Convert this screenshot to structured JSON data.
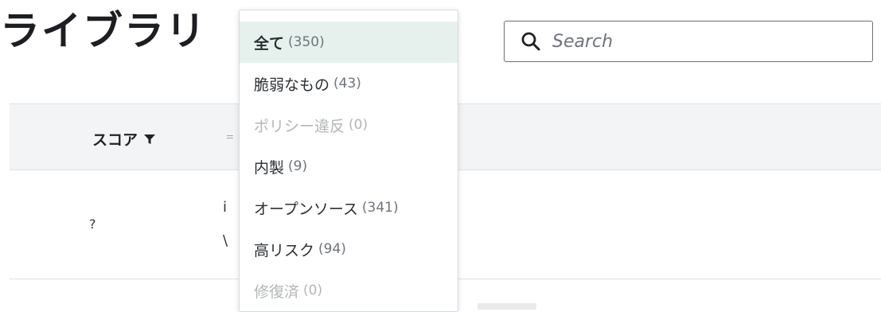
{
  "page": {
    "title": "ライブラリ"
  },
  "search": {
    "placeholder": "Search",
    "icon": "search-icon"
  },
  "table": {
    "header": {
      "score_label": "スコア",
      "score_filter_icon": "filter-icon",
      "second_column_fragment": "゠"
    },
    "rows": [
      {
        "score": "?",
        "fragment_line1": "i",
        "fragment_line2": "\\"
      }
    ]
  },
  "filter_dropdown": {
    "items": [
      {
        "label": "全て",
        "count": "(350)",
        "state": "selected"
      },
      {
        "label": "脆弱なもの",
        "count": "(43)",
        "state": "normal"
      },
      {
        "label": "ポリシー違反",
        "count": "(0)",
        "state": "disabled"
      },
      {
        "label": "内製",
        "count": "(9)",
        "state": "normal"
      },
      {
        "label": "オープンソース",
        "count": "(341)",
        "state": "normal"
      },
      {
        "label": "高リスク",
        "count": "(94)",
        "state": "normal"
      },
      {
        "label": "修復済",
        "count": "(0)",
        "state": "disabled"
      }
    ]
  },
  "colors": {
    "selected_bg": "#e6f1ee",
    "header_bg": "#f3f4f5",
    "disabled_text": "#b3b6b9",
    "count_text": "#6f747a"
  }
}
